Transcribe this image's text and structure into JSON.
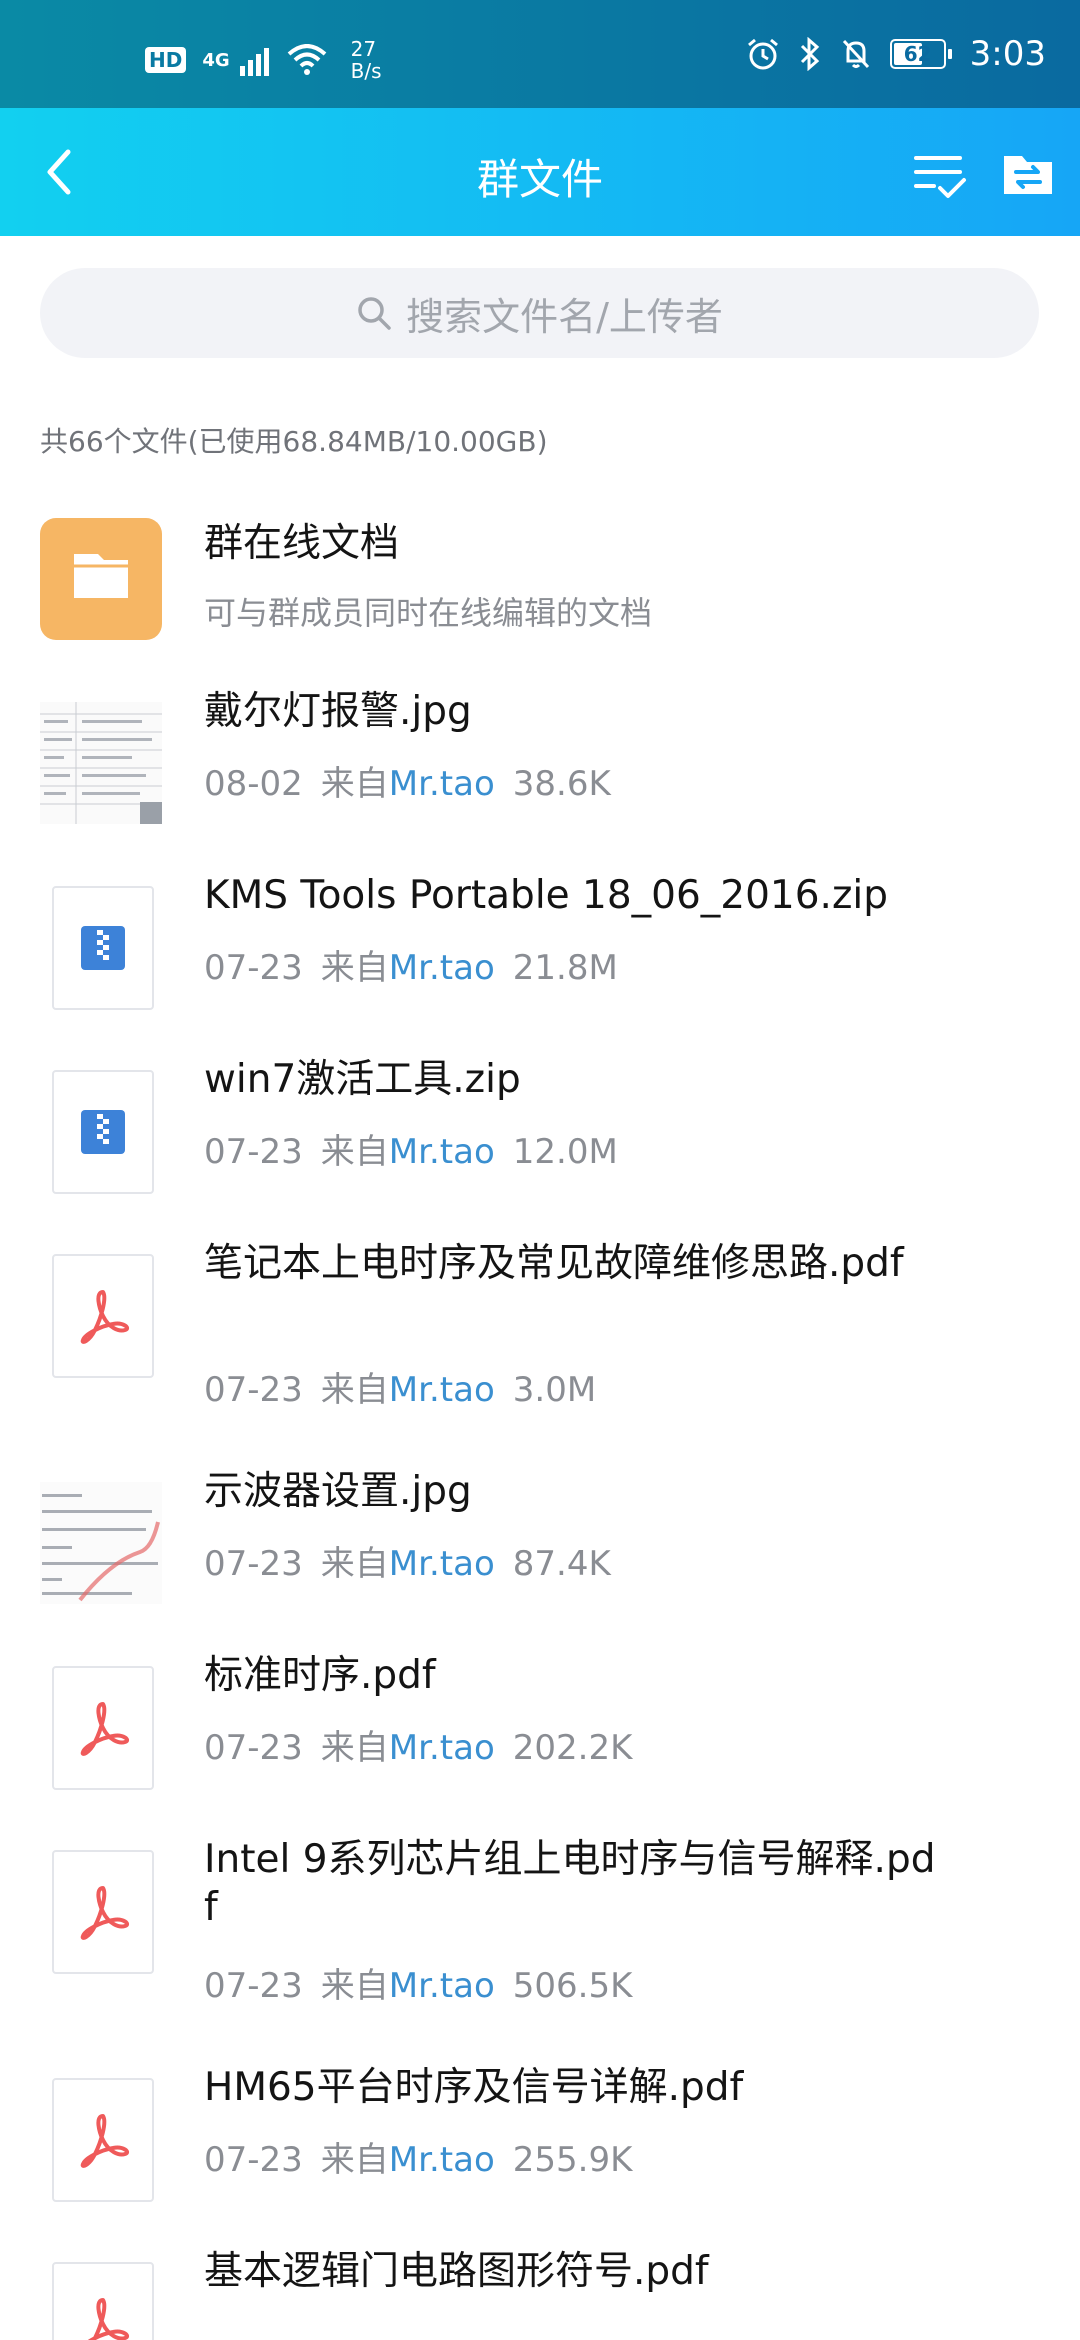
{
  "status_bar": {
    "hd": "HD",
    "network": "4G",
    "speed_value": "27",
    "speed_unit": "B/s",
    "battery": "62",
    "time": "3:03"
  },
  "header": {
    "title": "群文件",
    "back_icon": "back-arrow-icon",
    "multiselect_icon": "list-check-icon",
    "folder_icon": "folder-transfer-icon"
  },
  "search": {
    "placeholder": "搜索文件名/上传者"
  },
  "summary": "共66个文件(已使用68.84MB/10.00GB)",
  "files": [
    {
      "name": "群在线文档",
      "subtitle": "可与群成员同时在线编辑的文档",
      "type": "folder"
    },
    {
      "name": "戴尔灯报警.jpg",
      "date": "08-02",
      "from": "来自",
      "uploader": "Mr.tao",
      "size": "38.6K",
      "type": "image"
    },
    {
      "name": "KMS Tools Portable 18_06_2016.zip",
      "date": "07-23",
      "from": "来自",
      "uploader": "Mr.tao",
      "size": "21.8M",
      "type": "zip"
    },
    {
      "name": "win7激活工具.zip",
      "date": "07-23",
      "from": "来自",
      "uploader": "Mr.tao",
      "size": "12.0M",
      "type": "zip"
    },
    {
      "name": "笔记本上电时序及常见故障维修思路.pdf",
      "date": "07-23",
      "from": "来自",
      "uploader": "Mr.tao",
      "size": "3.0M",
      "type": "pdf"
    },
    {
      "name": "示波器设置.jpg",
      "date": "07-23",
      "from": "来自",
      "uploader": "Mr.tao",
      "size": "87.4K",
      "type": "image"
    },
    {
      "name": "标准时序.pdf",
      "date": "07-23",
      "from": "来自",
      "uploader": "Mr.tao",
      "size": "202.2K",
      "type": "pdf"
    },
    {
      "name": "Intel 9系列芯片组上电时序与信号解释.pdf",
      "date": "07-23",
      "from": "来自",
      "uploader": "Mr.tao",
      "size": "506.5K",
      "type": "pdf"
    },
    {
      "name": "HM65平台时序及信号详解.pdf",
      "date": "07-23",
      "from": "来自",
      "uploader": "Mr.tao",
      "size": "255.9K",
      "type": "pdf"
    },
    {
      "name": "基本逻辑门电路图形符号.pdf",
      "type": "pdf"
    }
  ],
  "colors": {
    "accent": "#16a6f6",
    "uploader_link": "#3a8fd0",
    "folder": "#f6b664",
    "zip": "#3d82d8",
    "pdf": "#ef5a5a"
  }
}
